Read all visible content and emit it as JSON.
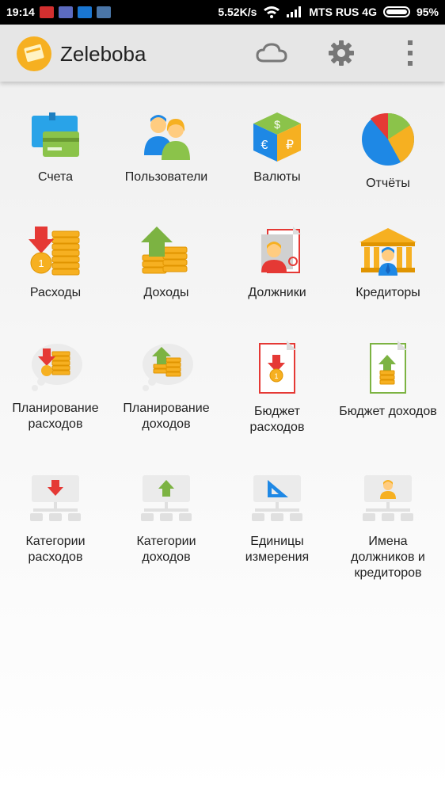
{
  "status_bar": {
    "time": "19:14",
    "speed": "5.52K/s",
    "carrier": "MTS RUS 4G",
    "battery": "95%"
  },
  "app_bar": {
    "title": "Zeleboba",
    "icons": [
      "cloud-icon",
      "settings-icon",
      "more-vert-icon"
    ]
  },
  "tiles": [
    {
      "label": "Счета",
      "icon": "accounts-icon"
    },
    {
      "label": "Пользователи",
      "icon": "users-icon"
    },
    {
      "label": "Валюты",
      "icon": "currencies-icon"
    },
    {
      "label": "Отчёты",
      "icon": "reports-pie-icon"
    },
    {
      "label": "Расходы",
      "icon": "expenses-icon"
    },
    {
      "label": "Доходы",
      "icon": "income-icon"
    },
    {
      "label": "Должники",
      "icon": "debtors-icon"
    },
    {
      "label": "Кредиторы",
      "icon": "creditors-icon"
    },
    {
      "label": "Планирование\nрасходов",
      "icon": "plan-expenses-icon"
    },
    {
      "label": "Планирование\nдоходов",
      "icon": "plan-income-icon"
    },
    {
      "label": "Бюджет\nрасходов",
      "icon": "budget-expenses-icon"
    },
    {
      "label": "Бюджет доходов",
      "icon": "budget-income-icon"
    },
    {
      "label": "Категории\nрасходов",
      "icon": "expense-categories-icon"
    },
    {
      "label": "Категории\nдоходов",
      "icon": "income-categories-icon"
    },
    {
      "label": "Единицы\nизмерения",
      "icon": "units-icon"
    },
    {
      "label": "Имена\nдолжников и\nкредиторов",
      "icon": "names-icon"
    }
  ],
  "colors": {
    "app_bar_bg": "#e6e6e6",
    "accent_orange": "#f6b021",
    "red": "#e53935",
    "green": "#7cb342",
    "blue": "#1e88e5"
  }
}
